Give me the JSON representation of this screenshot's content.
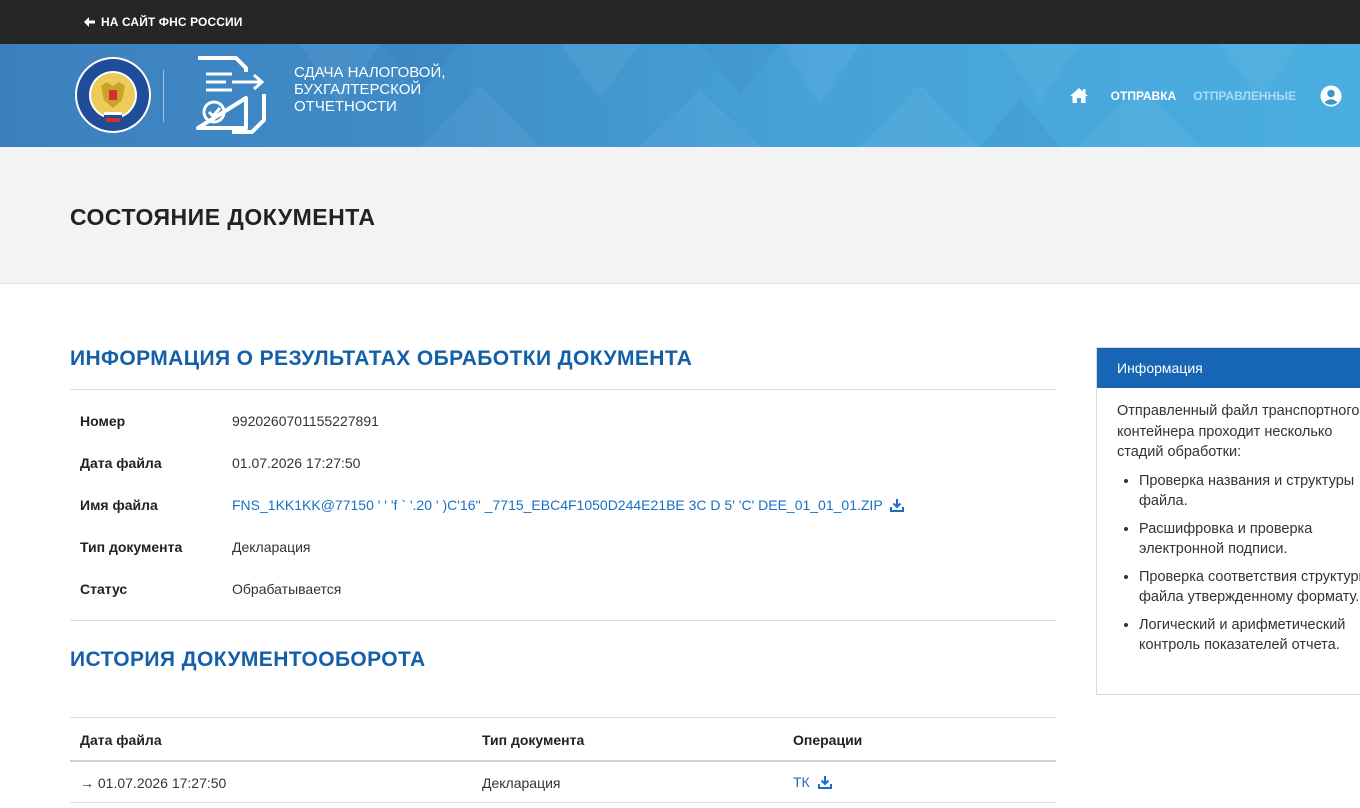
{
  "topbar": {
    "back_label": "НА САЙТ ФНС РОССИИ"
  },
  "header": {
    "brand_lines": [
      "СДАЧА НАЛОГОВОЙ,",
      "БУХГАЛТЕРСКОЙ",
      "ОТЧЕТНОСТИ"
    ],
    "nav": {
      "send_label": "ОТПРАВКА",
      "sent_label": "ОТПРАВЛЕННЫЕ"
    }
  },
  "page": {
    "title": "СОСТОЯНИЕ ДОКУМЕНТА"
  },
  "info_section": {
    "title": "ИНФОРМАЦИЯ О РЕЗУЛЬТАТАХ ОБРАБОТКИ ДОКУМЕНТА",
    "rows": [
      {
        "label": "Номер",
        "value": "9920260701155227891"
      },
      {
        "label": "Дата файла",
        "value": "01.07.2026 17:27:50"
      },
      {
        "label": "Имя файла",
        "value": "FNS_1KK1KK@77150 ' ' 'f ` '.20 ' )C'16'' _7715_EBC4F1050D244E21BE 3C D 5' 'C' DEE_01_01_01.ZIP"
      },
      {
        "label": "Тип документа",
        "value": "Декларация"
      },
      {
        "label": "Статус",
        "value": "Обрабатывается"
      }
    ]
  },
  "history_section": {
    "title": "ИСТОРИЯ ДОКУМЕНТООБОРОТА",
    "columns": [
      "Дата файла",
      "Тип документа",
      "Операции"
    ],
    "rows": [
      {
        "date": "→ 01.07.2026 17:27:50",
        "type": "Декларация",
        "operation": "ТК"
      }
    ]
  },
  "info_panel": {
    "title": "Информация",
    "intro_lines": [
      "Отправленный файл транспортного",
      "контейнера проходит несколько",
      "стадий обработки:"
    ],
    "items": [
      {
        "line1": "Проверка названия и структуры",
        "line2": "файла."
      },
      {
        "line1": "Расшифровка и проверка",
        "line2": "электронной подписи."
      },
      {
        "line1": "Проверка соответствия структуры",
        "line2": "файла утвержденному формату."
      },
      {
        "line1": "Логический и арифметический",
        "line2": "контроль показателей отчета."
      }
    ]
  },
  "colors": {
    "brand_blue": "#1460a8",
    "link_blue": "#1a6fc4",
    "panel_header": "#1766b5",
    "topbar": "#262626"
  }
}
